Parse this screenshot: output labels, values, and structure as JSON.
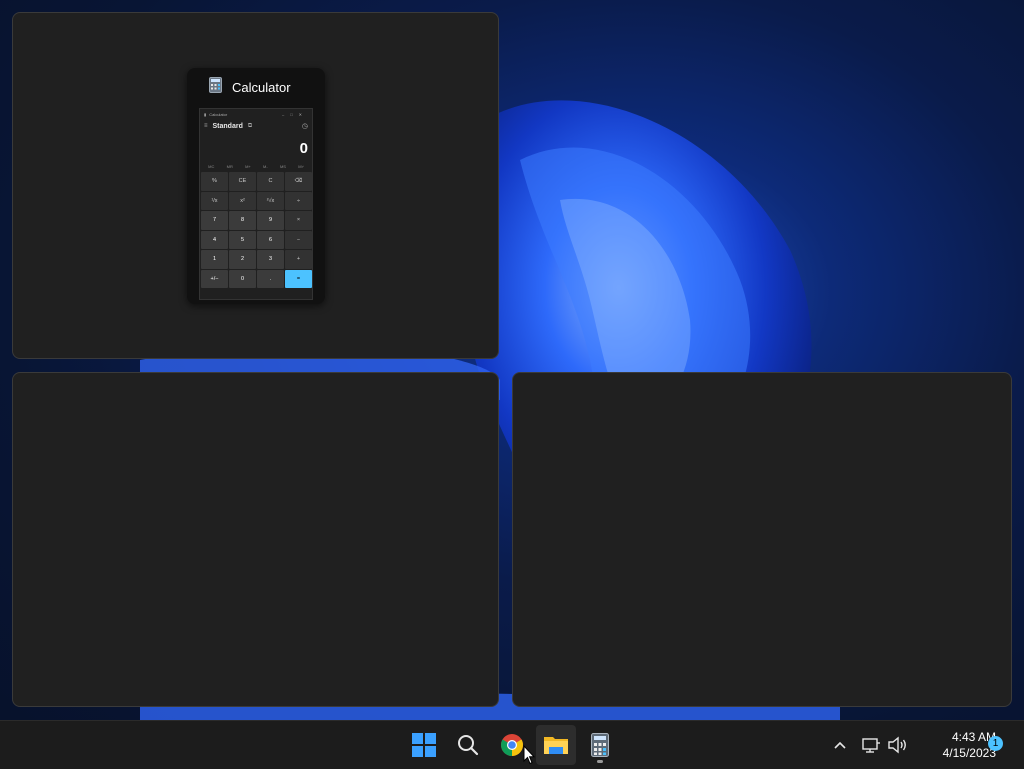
{
  "snap_layout": {
    "top_left": {
      "window_title": "Calculator",
      "calculator": {
        "title": "Calculator",
        "mode": "Standard",
        "display": "0",
        "memory_buttons": [
          "MC",
          "MR",
          "M+",
          "M-",
          "MS",
          "M˅"
        ],
        "keys": [
          "%",
          "CE",
          "C",
          "⌫",
          "¹/x",
          "x²",
          "²√x",
          "÷",
          "7",
          "8",
          "9",
          "×",
          "4",
          "5",
          "6",
          "−",
          "1",
          "2",
          "3",
          "+",
          "+/−",
          "0",
          ".",
          "="
        ]
      }
    }
  },
  "taskbar": {
    "apps": [
      {
        "name": "Start",
        "icon": "windows-logo-icon"
      },
      {
        "name": "Search",
        "icon": "search-icon"
      },
      {
        "name": "Google Chrome",
        "icon": "chrome-icon"
      },
      {
        "name": "File Explorer",
        "icon": "folder-icon"
      },
      {
        "name": "Calculator",
        "icon": "calculator-icon",
        "running": true
      }
    ],
    "tray": {
      "time": "4:43 AM",
      "date": "4/15/2023",
      "notification_count": "1"
    }
  },
  "colors": {
    "accent": "#4cc2ff",
    "zone_bg": "#202020",
    "taskbar_bg": "#1c1c1c"
  }
}
